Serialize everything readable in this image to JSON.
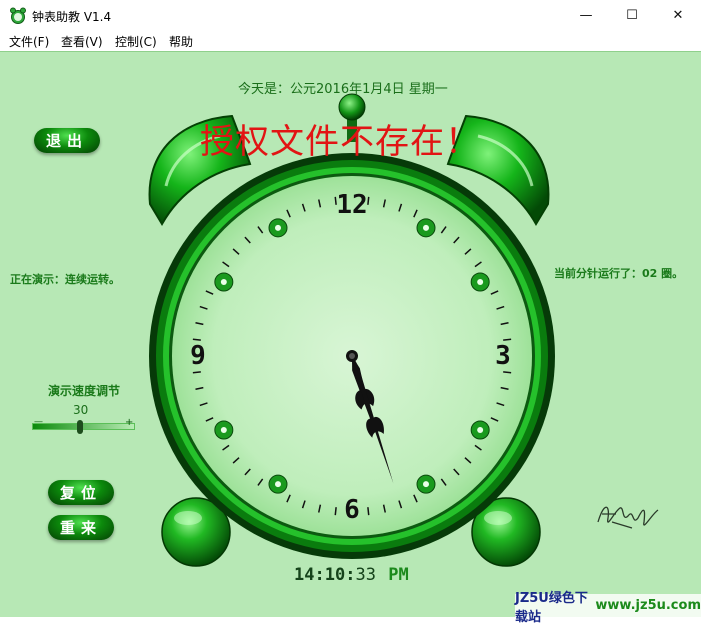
{
  "window": {
    "title": "钟表助教 V1.4",
    "minimize_glyph": "—",
    "maximize_glyph": "☐",
    "close_glyph": "✕"
  },
  "menu": [
    {
      "label": "文件(F)"
    },
    {
      "label": "查看(V)"
    },
    {
      "label": "控制(C)"
    },
    {
      "label": "帮助"
    }
  ],
  "header": {
    "date_text": "今天是：公元2016年1月4日  星期一"
  },
  "buttons": {
    "exit_label": "退出",
    "reset_label": "复位",
    "restart_label": "重来"
  },
  "status": {
    "demo_status": "正在演示：连续运转。",
    "minute_hand_runs": "当前分针运行了：02 圈。"
  },
  "speed": {
    "label": "演示速度调节",
    "value": "30",
    "minus": "—",
    "plus": "+",
    "level_fraction": 0.48
  },
  "warning": "授权文件不存在！",
  "clock": {
    "numerals": [
      "12",
      "3",
      "6",
      "9"
    ],
    "hour": 5,
    "minute": 27
  },
  "digital_time": {
    "hh": "14",
    "mm": "10",
    "ss": "33",
    "ampm": "PM"
  },
  "watermark": {
    "left": "JZ5U绿色下载站",
    "right": "www.jz5u.com"
  },
  "colors": {
    "accent_green": "#0c8a0c",
    "background": "#b7e8b5",
    "warning_red": "#e21414"
  }
}
